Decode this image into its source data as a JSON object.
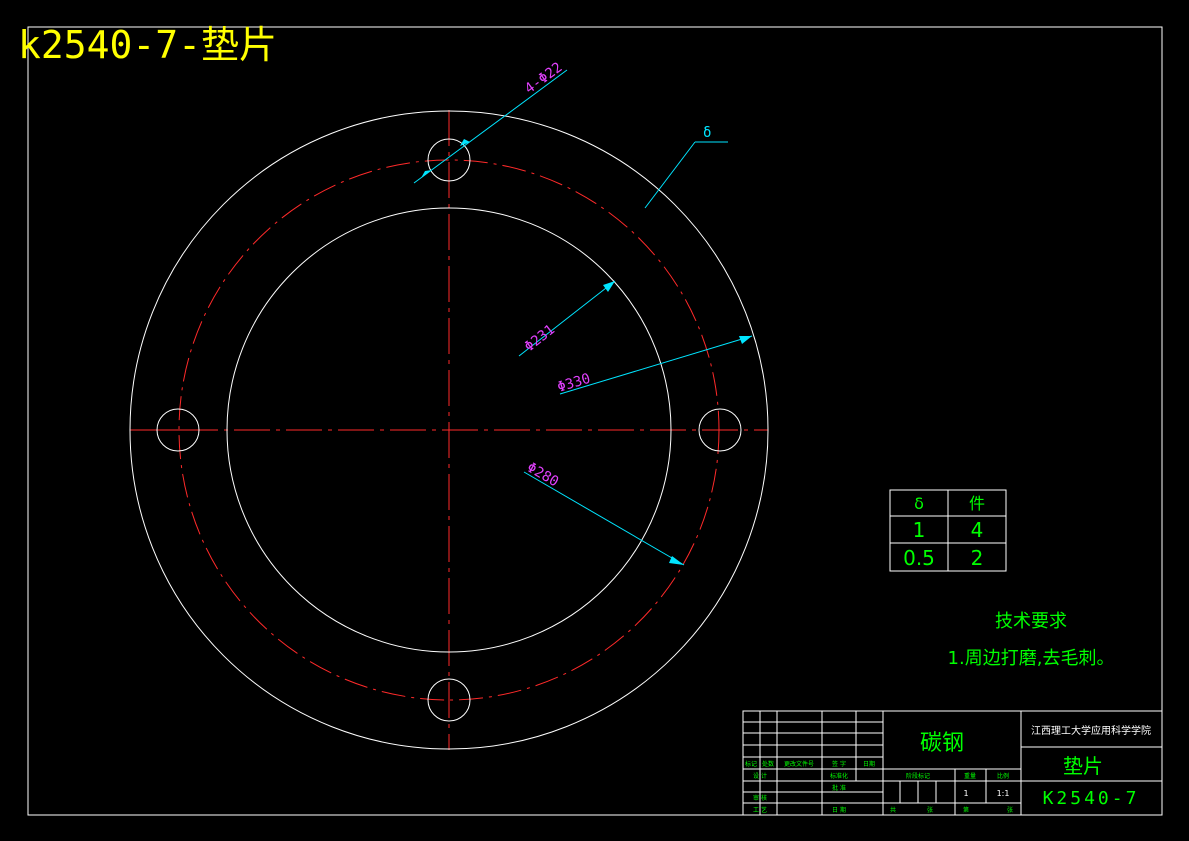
{
  "title": "k2540-7-垫片",
  "dims": {
    "holes": "4-Φ22",
    "inner": "Φ231",
    "outer": "Φ330",
    "pcd": "Φ280",
    "thickness": "δ"
  },
  "spec_table": {
    "headers": [
      "δ",
      "件"
    ],
    "rows": [
      [
        "1",
        "4"
      ],
      [
        "0.5",
        "2"
      ]
    ]
  },
  "tech_req": {
    "heading": "技术要求",
    "item": "1.周边打磨,去毛刺。"
  },
  "title_block": {
    "material": "碳钢",
    "school": "江西理工大学应用科学学院",
    "part_name": "垫片",
    "drawing_no": "K2540-7",
    "small": {
      "r1": [
        "标记",
        "处数",
        "更改文件号",
        "签 字",
        "日期"
      ],
      "r2": [
        "设 计",
        "标准化",
        "阶段标记",
        "重量",
        "比例"
      ],
      "r3": [
        "审 核",
        "批 准"
      ],
      "r4": [
        "工 艺",
        "日 期",
        "共",
        "张",
        "第",
        "张"
      ],
      "qty": "1",
      "scale": "1:1"
    }
  },
  "colors": {
    "outline": "#ffffff",
    "centerline": "#ff2a2a",
    "dimension": "#00e5ff",
    "dim_text": "#e040fb",
    "label": "#00ff00",
    "title": "#ffff00"
  }
}
